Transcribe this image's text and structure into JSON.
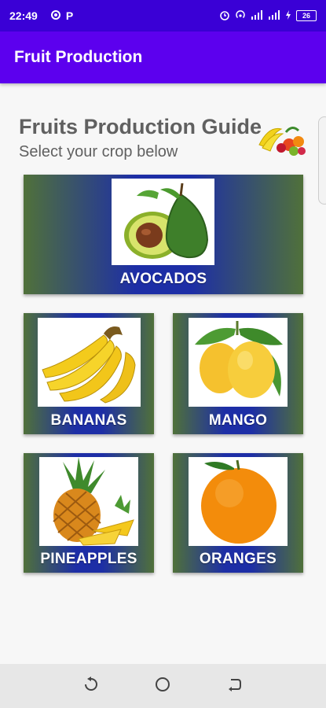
{
  "status_bar": {
    "time": "22:49",
    "left_icons": [
      "settings-icon",
      "p-app-icon"
    ],
    "right_icons": [
      "alarm-icon",
      "hotspot-icon",
      "signal-icon",
      "signal-icon",
      "charging-icon"
    ],
    "p_letter": "P",
    "battery_level": "26"
  },
  "app_bar": {
    "title": "Fruit Production"
  },
  "header": {
    "title": "Fruits Production Guide",
    "subtitle": "Select your crop below"
  },
  "crops": [
    {
      "label": "AVOCADOS"
    },
    {
      "label": "BANANAS"
    },
    {
      "label": "MANGO"
    },
    {
      "label": "PINEAPPLES"
    },
    {
      "label": "ORANGES"
    }
  ],
  "colors": {
    "status_bar": "#3a00d6",
    "app_bar": "#5c00ee",
    "card_edge": "#50713a",
    "card_center": "#1d2ea6"
  },
  "nav_bar": {
    "buttons": [
      "recent-apps-icon",
      "home-icon",
      "back-icon"
    ]
  }
}
